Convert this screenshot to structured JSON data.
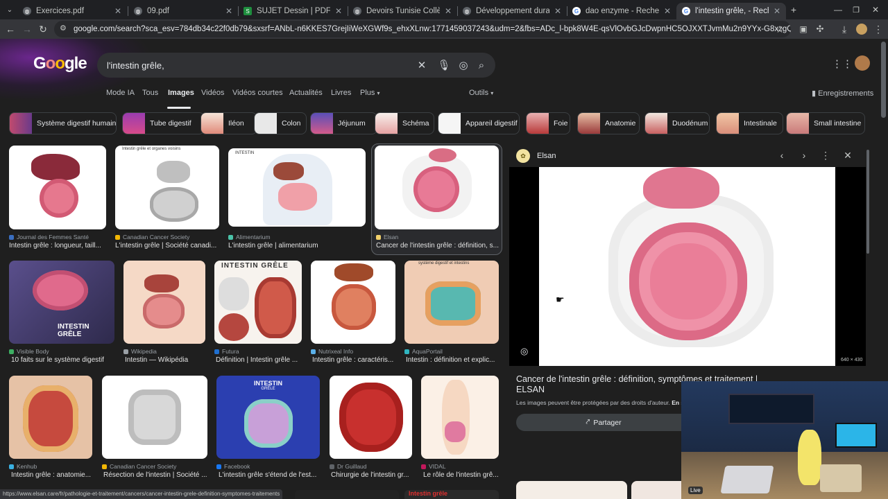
{
  "tabs": [
    {
      "title": "Exercices.pdf",
      "icon": "globe-icon"
    },
    {
      "title": "09.pdf",
      "icon": "globe-icon"
    },
    {
      "title": "SUJET Dessin | PDF",
      "icon": "scribd-icon"
    },
    {
      "title": "Devoirs Tunisie Collège",
      "icon": "globe-icon"
    },
    {
      "title": "Développement durable & Éco",
      "icon": "globe-icon"
    },
    {
      "title": "dao enzyme - Recherche Goog",
      "icon": "google-icon"
    },
    {
      "title": "l'intestin grêle, - Recherche Go",
      "icon": "google-icon"
    }
  ],
  "address": {
    "url": "google.com/search?sca_esv=784db34c22f0db79&sxsrf=ANbL-n6KKES7GrejIiWeXGWf9s_ehxXLnw:1771459037243&udm=2&fbs=ADc_l-bpk8W4E-qsVlOvbGJcDwpnHC5OJXXTJvmMu2n9YYx-G8xzgQk24aW1N_FyIND5zVDd4bb14119C8nZHL5l4..."
  },
  "search": {
    "query": "l'intestin grêle,"
  },
  "nav": {
    "items": [
      "Mode IA",
      "Tous",
      "Images",
      "Vidéos",
      "Vidéos courtes",
      "Actualités",
      "Livres",
      "Plus"
    ],
    "tools": "Outils",
    "saved": "Enregistrements"
  },
  "chips": [
    "Système digestif humain",
    "Tube digestif",
    "Iléon",
    "Colon",
    "Jéjunum",
    "Schéma",
    "Appareil digestif",
    "Foie",
    "Anatomie",
    "Duodénum",
    "Intestinale",
    "Small intestine"
  ],
  "results": [
    {
      "source": "Journal des Femmes Santé",
      "caption": "Intestin grêle : longueur, taill..."
    },
    {
      "source": "Canadian Cancer Society",
      "caption": "L'intestin grêle | Société canadi..."
    },
    {
      "source": "Alimentarium",
      "caption": "L'intestin grêle | alimentarium"
    },
    {
      "source": "Elsan",
      "caption": "Cancer de l'intestin grêle : définition, s..."
    },
    {
      "source": "Visible Body",
      "caption": "10 faits sur le système digestif"
    },
    {
      "source": "Wikipedia",
      "caption": "Intestin — Wikipédia"
    },
    {
      "source": "Futura",
      "caption": "Définition | Intestin grêle ..."
    },
    {
      "source": "Nutrixeal Info",
      "caption": "Intestin grêle : caractéris..."
    },
    {
      "source": "AquaPortail",
      "caption": "Intestin : définition et explic..."
    },
    {
      "source": "Kenhub",
      "caption": "Intestin grêle : anatomie..."
    },
    {
      "source": "Canadian Cancer Society",
      "caption": "Résection de l'intestin | Société ..."
    },
    {
      "source": "Facebook",
      "caption": "L'intestin grêle s'étend de l'est..."
    },
    {
      "source": "Dr Guillaud",
      "caption": "Chirurgie de l'intestin gr..."
    },
    {
      "source": "VIDAL",
      "caption": "Le rôle de l'intestin grê..."
    }
  ],
  "thumb_labels": {
    "r1c2": "Intestin grêle et organes voisins",
    "r1c3": "INTESTIN",
    "r2c1": "INTESTIN GRÊLE",
    "r2c3": "INTESTIN GRÊLE",
    "r2c5": "système digestif et intestins",
    "r3c3_title": "INTESTIN",
    "r3c3_sub": "GRÊLE",
    "r4_partial": "Intestin grêle"
  },
  "panel": {
    "source": "Elsan",
    "title": "Cancer de l'intestin grêle : définition, symptômes et traitement | ELSAN",
    "dimensions": "640 × 430",
    "notice": "Les images peuvent être protégées par des droits d'auteur.",
    "notice_link": "En sav",
    "share": "Partager"
  },
  "statusbar": {
    "url": "https://www.elsan.care/fr/pathologie-et-traitement/cancers/cancer-intestin-grele-definition-symptomes-traitements"
  },
  "webcam": {
    "badge": "Live"
  }
}
